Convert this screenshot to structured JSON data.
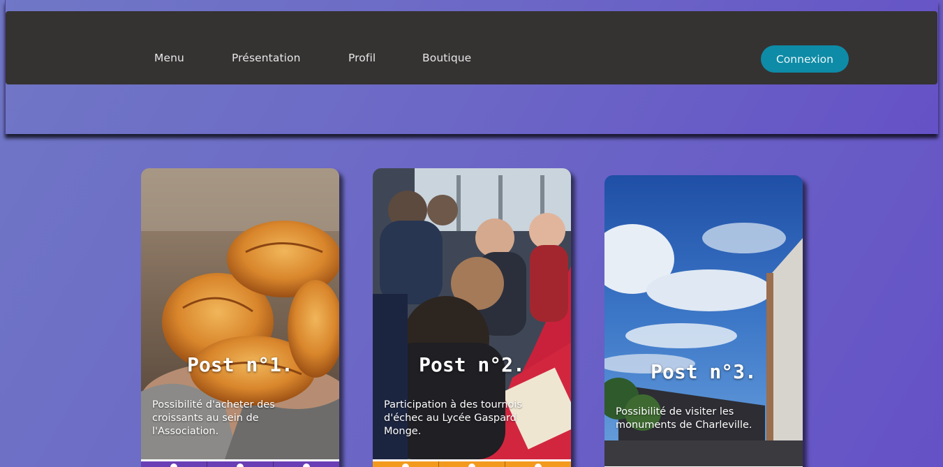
{
  "nav": {
    "items": [
      "Menu",
      "Présentation",
      "Profil",
      "Boutique"
    ],
    "login_label": "Connexion"
  },
  "colors": {
    "navbar": "#353232",
    "login_button": "#0e8ba6",
    "card1_footer": "#6a3fb5",
    "card2_footer": "#f39a1e",
    "card3_footer": "#b5412f"
  },
  "posts": [
    {
      "title": "Post n°1.",
      "text": "Possibilité d'acheter des croissants au sein de l'Association.",
      "image": "croissants-photo"
    },
    {
      "title": "Post n°2.",
      "text": "Participation à des tournois d'échec au Lycée Gaspard Monge.",
      "image": "chess-tournament-photo"
    },
    {
      "title": "Post n°3.",
      "text": "Possibilité de visiter les monuments de Charleville.",
      "image": "sky-building-photo"
    }
  ],
  "footer_icons": [
    "heart-icon",
    "comment-icon",
    "share-icon"
  ]
}
